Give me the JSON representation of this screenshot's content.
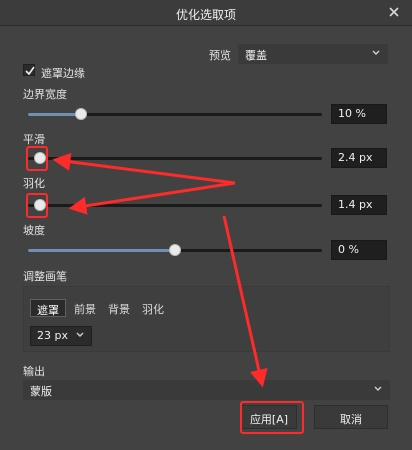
{
  "window": {
    "title": "优化选取项"
  },
  "preview": {
    "label": "预览",
    "value": "覆盖"
  },
  "mask_edge": {
    "label": "遮罩边缘",
    "checked": true
  },
  "sliders": {
    "border_width": {
      "label": "边界宽度",
      "value": "10 %",
      "level": 0.18
    },
    "smooth": {
      "label": "平滑",
      "value": "2.4 px",
      "level": 0.04
    },
    "feather": {
      "label": "羽化",
      "value": "1.4 px",
      "level": 0.04
    },
    "slope": {
      "label": "坡度",
      "value": "0 %",
      "level": 0.5
    }
  },
  "brush": {
    "label": "调整画笔",
    "tabs": [
      "遮罩",
      "前景",
      "背景",
      "羽化"
    ],
    "active_tab": 0,
    "size": "23 px"
  },
  "output": {
    "label": "输出",
    "value": "蒙版"
  },
  "buttons": {
    "apply": "应用[A]",
    "cancel": "取消"
  },
  "colors": {
    "annotation": "#ff2a2a",
    "accent_track": "#6f8fb3"
  }
}
